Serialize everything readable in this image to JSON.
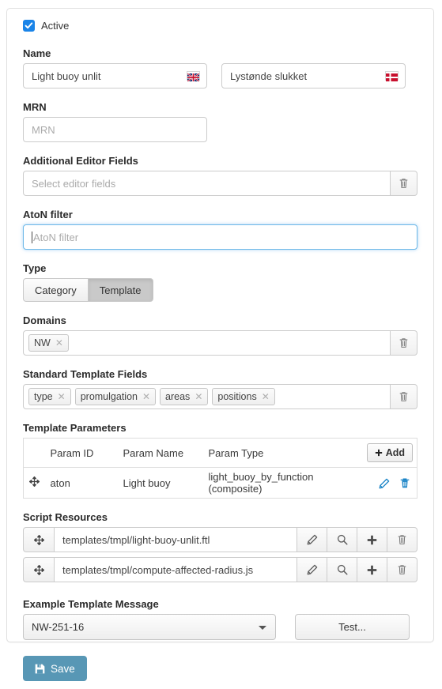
{
  "form": {
    "active": {
      "label": "Active",
      "checked": true
    },
    "name": {
      "label": "Name",
      "en": {
        "value": "Light buoy unlit",
        "flag": "flag-gb-icon"
      },
      "da": {
        "value": "Lystønde slukket",
        "flag": "flag-dk-icon"
      }
    },
    "mrn": {
      "label": "MRN",
      "value": "",
      "placeholder": "MRN"
    },
    "additional_editor_fields": {
      "label": "Additional Editor Fields",
      "value": "",
      "placeholder": "Select editor fields",
      "delete_icon": "trash-icon"
    },
    "aton_filter": {
      "label": "AtoN filter",
      "value": "",
      "placeholder": "AtoN filter",
      "focused": true
    },
    "type": {
      "label": "Type",
      "options": [
        "Category",
        "Template"
      ],
      "selected": "Template"
    },
    "domains": {
      "label": "Domains",
      "tags": [
        "NW"
      ],
      "delete_icon": "trash-icon"
    },
    "standard_template_fields": {
      "label": "Standard Template Fields",
      "tags": [
        "type",
        "promulgation",
        "areas",
        "positions"
      ],
      "delete_icon": "trash-icon"
    },
    "template_parameters": {
      "label": "Template Parameters",
      "add_label": "Add",
      "columns": [
        "",
        "Param ID",
        "Param Name",
        "Param Type",
        ""
      ],
      "rows": [
        {
          "handle": "move-handle-icon",
          "param_id": "aton",
          "param_name": "Light buoy",
          "param_type": "light_buoy_by_function (composite)",
          "edit_icon": "pencil-icon",
          "delete_icon": "trash-icon"
        }
      ]
    },
    "script_resources": {
      "label": "Script Resources",
      "rows": [
        {
          "path": "templates/tmpl/light-buoy-unlit.ftl"
        },
        {
          "path": "templates/tmpl/compute-affected-radius.js"
        }
      ],
      "row_icons": [
        "pencil-icon",
        "search-icon",
        "plus-icon",
        "trash-icon"
      ]
    },
    "example_template_message": {
      "label": "Example Template Message",
      "selected": "NW-251-16",
      "test_label": "Test..."
    },
    "save": {
      "label": "Save",
      "icon": "floppy-disk-icon"
    }
  },
  "colors": {
    "accent_blue": "#1a84e8",
    "save_blue": "#5897b5",
    "focus_blue": "#6cb8e8",
    "flag_red": "#e8112d",
    "icon_gray": "#6a6a6a"
  }
}
